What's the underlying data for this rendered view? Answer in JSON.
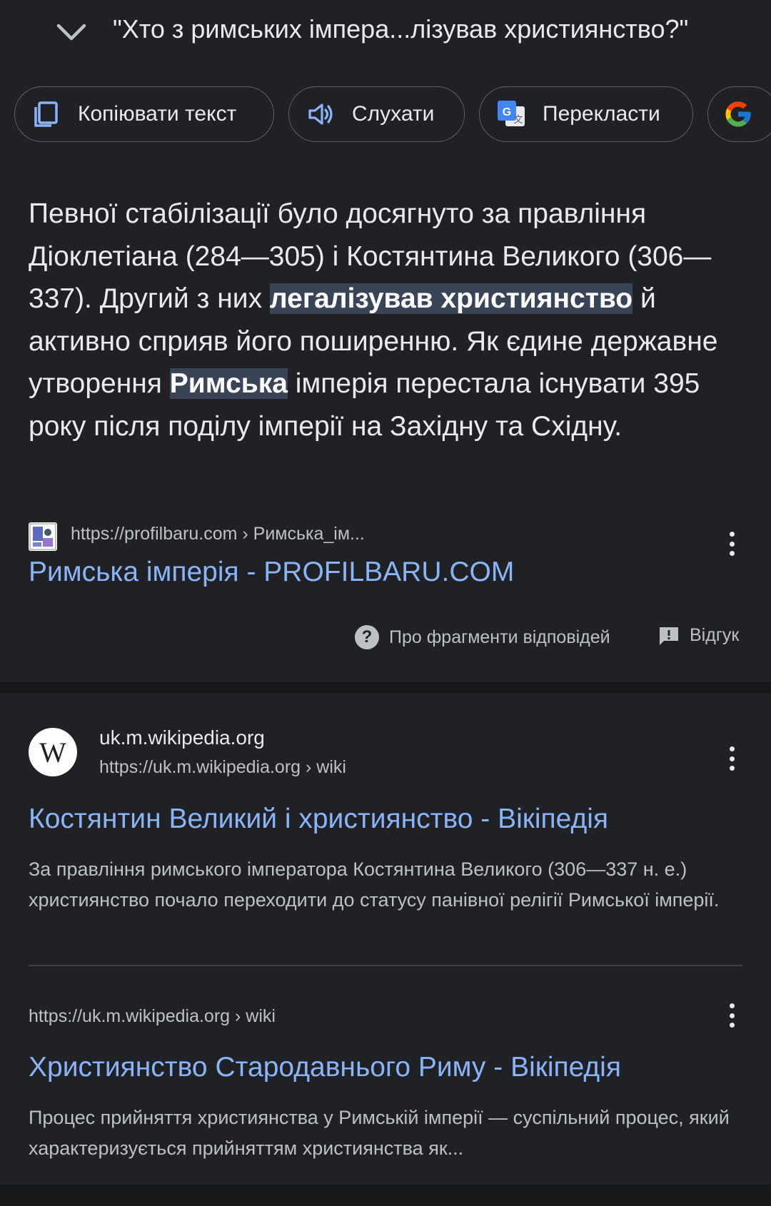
{
  "header": {
    "query": "\"Хто з римських імпера...лізував християнство?\"",
    "collapse_icon": "chevron-down-icon"
  },
  "chips": [
    {
      "label": "Копіювати текст",
      "icon": "copy-icon"
    },
    {
      "label": "Слухати",
      "icon": "speaker-icon"
    },
    {
      "label": "Перекласти",
      "icon": "translate-icon"
    },
    {
      "label": "",
      "icon": "google-icon"
    }
  ],
  "snippet": {
    "text_1": "Певної стабілізації було досягнуто за правління Діоклетіана (284—305) і Костянтина Великого (306—337). Другий з них ",
    "highlight_1": "легалізував християнство",
    "text_2": " й активно сприяв його поширенню. Як єдине державне утворення ",
    "highlight_2": "Римська",
    "text_3": " імперія перестала існувати 395 року після поділу імперії на Західну та Східну.",
    "source_url": "https://profilbaru.com › Римська_ім...",
    "source_title": "Римська імперія - PROFILBARU.COM",
    "about_label": "Про фрагменти відповідей",
    "feedback_label": "Відгук"
  },
  "results": [
    {
      "site_name": "uk.m.wikipedia.org",
      "url": "https://uk.m.wikipedia.org › wiki",
      "logo_letter": "W",
      "title": "Костянтин Великий і християнство - Вікіпедія",
      "description": "За правління римського імператора Костянтина Великого (306—337 н. е.) християнство почало переходити до статусу панівної релігії Римської імперії."
    },
    {
      "url": "https://uk.m.wikipedia.org › wiki",
      "title": "Християнство Стародавнього Риму - Вікіпедія",
      "description": "Процес прийняття християнства у Римській імперії — суспільний процес, який характеризується прийняттям християнства як..."
    }
  ],
  "colors": {
    "background": "#202124",
    "link": "#8ab4f8",
    "highlight": "#394457",
    "text": "#e8eaed",
    "muted": "#bdc1c6"
  }
}
